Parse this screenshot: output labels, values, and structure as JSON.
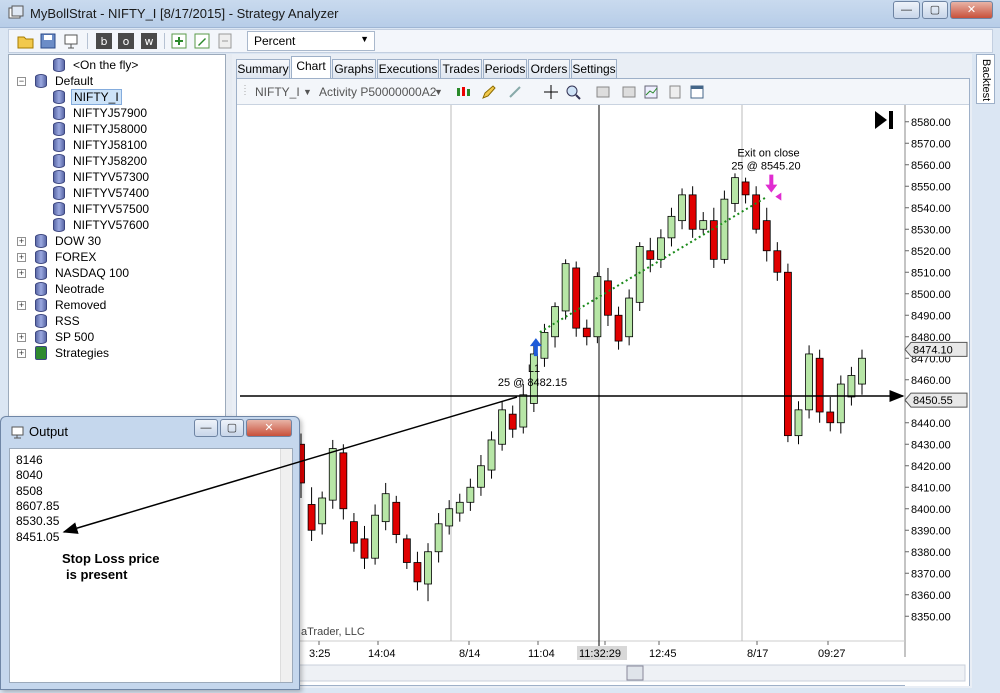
{
  "window": {
    "title": "MyBollStrat - NIFTY_I [8/17/2015] - Strategy Analyzer",
    "minimize": "—",
    "restore": "▢",
    "close": "✕"
  },
  "toolbar": {
    "mode_combo": "Percent",
    "buttons": [
      "open-folder-icon",
      "save-icon",
      "export-icon",
      "b-icon",
      "o-icon",
      "w-icon",
      "add-icon",
      "pencil-icon",
      "page-icon"
    ]
  },
  "tree": {
    "items": [
      {
        "label": "<On the fly>",
        "level": 2,
        "expander": ""
      },
      {
        "label": "Default",
        "level": 1,
        "expander": "−"
      },
      {
        "label": "NIFTY_I",
        "level": 2,
        "expander": "",
        "selected": true
      },
      {
        "label": "NIFTYJ57900",
        "level": 2,
        "expander": ""
      },
      {
        "label": "NIFTYJ58000",
        "level": 2,
        "expander": ""
      },
      {
        "label": "NIFTYJ58100",
        "level": 2,
        "expander": ""
      },
      {
        "label": "NIFTYJ58200",
        "level": 2,
        "expander": ""
      },
      {
        "label": "NIFTYV57300",
        "level": 2,
        "expander": ""
      },
      {
        "label": "NIFTYV57400",
        "level": 2,
        "expander": ""
      },
      {
        "label": "NIFTYV57500",
        "level": 2,
        "expander": ""
      },
      {
        "label": "NIFTYV57600",
        "level": 2,
        "expander": ""
      },
      {
        "label": "DOW 30",
        "level": 1,
        "expander": "+"
      },
      {
        "label": "FOREX",
        "level": 1,
        "expander": "+"
      },
      {
        "label": "NASDAQ 100",
        "level": 1,
        "expander": "+"
      },
      {
        "label": "Neotrade",
        "level": 1,
        "expander": ""
      },
      {
        "label": "Removed",
        "level": 1,
        "expander": "+"
      },
      {
        "label": "RSS",
        "level": 1,
        "expander": ""
      },
      {
        "label": "SP 500",
        "level": 1,
        "expander": "+"
      },
      {
        "label": "Strategies",
        "level": 1,
        "expander": "+"
      }
    ]
  },
  "tabs": [
    "Summary",
    "Chart",
    "Graphs",
    "Executions",
    "Trades",
    "Periods",
    "Orders",
    "Settings"
  ],
  "active_tab": "Chart",
  "side_tab": "Backtest",
  "chart_toolbar": {
    "instrument": "NIFTY_I",
    "indicator": "Activity P50000000A2"
  },
  "chart": {
    "y_ticks": [
      "8580.00",
      "8570.00",
      "8560.00",
      "8550.00",
      "8540.00",
      "8530.00",
      "8520.00",
      "8510.00",
      "8500.00",
      "8490.00",
      "8480.00",
      "8470.00",
      "8460.00",
      "8450.00",
      "8440.00",
      "8430.00",
      "8420.00",
      "8410.00",
      "8400.00",
      "8390.00",
      "8380.00",
      "8370.00",
      "8360.00",
      "8350.00"
    ],
    "x_labels": [
      "3:25",
      "14:04",
      "8/14",
      "11:04",
      "11:32:29",
      "12:45",
      "8/17",
      "09:27"
    ],
    "price_label_1": "8474.10",
    "price_label_2": "8450.55",
    "entry_label": "L1",
    "entry_detail": "25 @ 8482.15",
    "exit_label": "Exit on close",
    "exit_detail": "25 @ 8545.20",
    "watermark": "aTrader, LLC",
    "colors": {
      "up": "#b7e6a6",
      "down": "#e00000",
      "trade_line": "#1a8a1a"
    }
  },
  "chart_data": {
    "type": "candlestick",
    "ylim": [
      8345,
      8585
    ],
    "candles": [
      [
        8430,
        8412,
        8435,
        8405
      ],
      [
        8402,
        8390,
        8410,
        8385
      ],
      [
        8393,
        8405,
        8408,
        8388
      ],
      [
        8404,
        8428,
        8432,
        8400
      ],
      [
        8426,
        8400,
        8430,
        8395
      ],
      [
        8394,
        8384,
        8398,
        8380
      ],
      [
        8386,
        8377,
        8392,
        8372
      ],
      [
        8377,
        8397,
        8402,
        8374
      ],
      [
        8394,
        8407,
        8412,
        8390
      ],
      [
        8403,
        8388,
        8406,
        8384
      ],
      [
        8386,
        8375,
        8388,
        8372
      ],
      [
        8375,
        8366,
        8380,
        8362
      ],
      [
        8365,
        8380,
        8384,
        8357
      ],
      [
        8380,
        8393,
        8398,
        8375
      ],
      [
        8392,
        8400,
        8404,
        8388
      ],
      [
        8398,
        8403,
        8407,
        8394
      ],
      [
        8403,
        8410,
        8414,
        8399
      ],
      [
        8410,
        8420,
        8425,
        8406
      ],
      [
        8418,
        8432,
        8436,
        8414
      ],
      [
        8430,
        8446,
        8450,
        8427
      ],
      [
        8444,
        8437,
        8448,
        8433
      ],
      [
        8438,
        8453,
        8458,
        8435
      ],
      [
        8449,
        8472,
        8476,
        8445
      ],
      [
        8470,
        8482,
        8486,
        8466
      ],
      [
        8480,
        8494,
        8496,
        8475
      ],
      [
        8492,
        8514,
        8516,
        8488
      ],
      [
        8512,
        8484,
        8515,
        8480
      ],
      [
        8484,
        8480,
        8488,
        8476
      ],
      [
        8480,
        8508,
        8510,
        8477
      ],
      [
        8506,
        8490,
        8512,
        8485
      ],
      [
        8490,
        8478,
        8494,
        8474
      ],
      [
        8480,
        8498,
        8502,
        8476
      ],
      [
        8496,
        8522,
        8524,
        8492
      ],
      [
        8520,
        8516,
        8526,
        8510
      ],
      [
        8516,
        8526,
        8530,
        8512
      ],
      [
        8526,
        8536,
        8540,
        8522
      ],
      [
        8534,
        8546,
        8549,
        8530
      ],
      [
        8546,
        8530,
        8550,
        8526
      ],
      [
        8530,
        8534,
        8538,
        8528
      ],
      [
        8534,
        8516,
        8540,
        8512
      ],
      [
        8516,
        8544,
        8548,
        8514
      ],
      [
        8542,
        8554,
        8556,
        8538
      ],
      [
        8552,
        8546,
        8554,
        8542
      ],
      [
        8546,
        8530,
        8550,
        8528
      ],
      [
        8534,
        8520,
        8540,
        8515
      ],
      [
        8520,
        8510,
        8524,
        8506
      ],
      [
        8510,
        8434,
        8514,
        8431
      ],
      [
        8434,
        8446,
        8450,
        8430
      ],
      [
        8446,
        8472,
        8476,
        8442
      ],
      [
        8470,
        8445,
        8474,
        8440
      ],
      [
        8445,
        8440,
        8452,
        8436
      ],
      [
        8440,
        8458,
        8462,
        8435
      ],
      [
        8452,
        8462,
        8466,
        8448
      ],
      [
        8458,
        8470,
        8474,
        8453
      ]
    ],
    "entry": {
      "label": "L1",
      "qty": 25,
      "price": 8482.15
    },
    "exit": {
      "label": "Exit on close",
      "qty": 25,
      "price": 8545.2
    },
    "crosshair_price": 8450.55,
    "last_price": 8474.1
  },
  "output": {
    "title": "Output",
    "lines": [
      "8146",
      "8040",
      "8508",
      "8607.85",
      "8530.35",
      "8451.05"
    ],
    "note_line1": "Stop Loss price",
    "note_line2": "is present"
  }
}
